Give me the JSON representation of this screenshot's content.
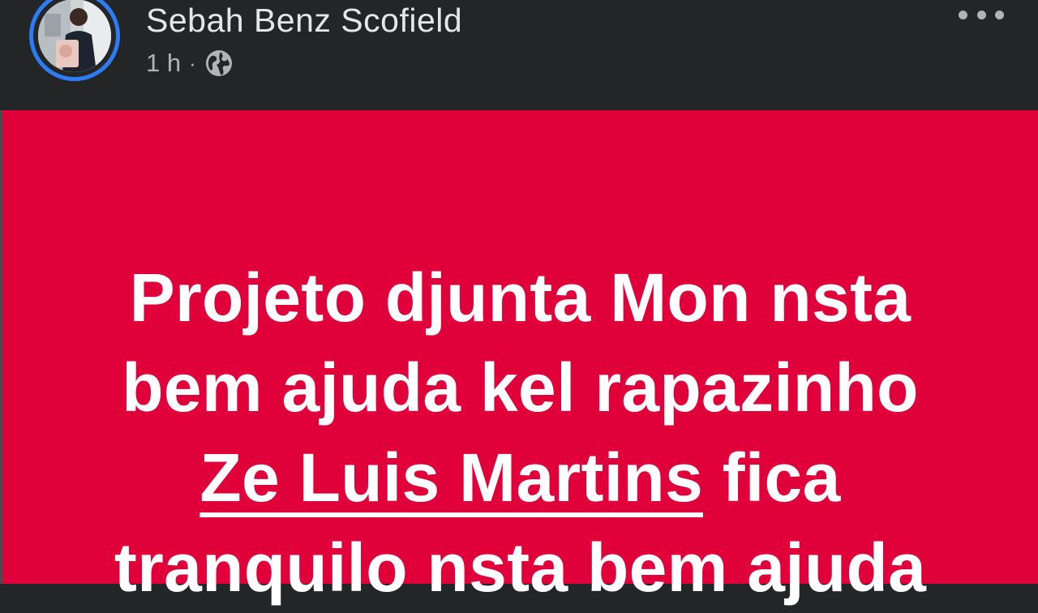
{
  "post": {
    "author": "Sebah Benz Scofield",
    "time": "1 h",
    "separator": "·",
    "audience_icon": "globe-icon",
    "more_icon": "more-horizontal-icon",
    "background_color": "#e0013a",
    "text": {
      "line1": "Projeto djunta Mon nsta",
      "line2": "bem ajuda kel rapazinho",
      "mention": "Ze Luis Martins",
      "line3_rest": " fica",
      "line4": "tranquilo nsta bem ajuda"
    }
  }
}
